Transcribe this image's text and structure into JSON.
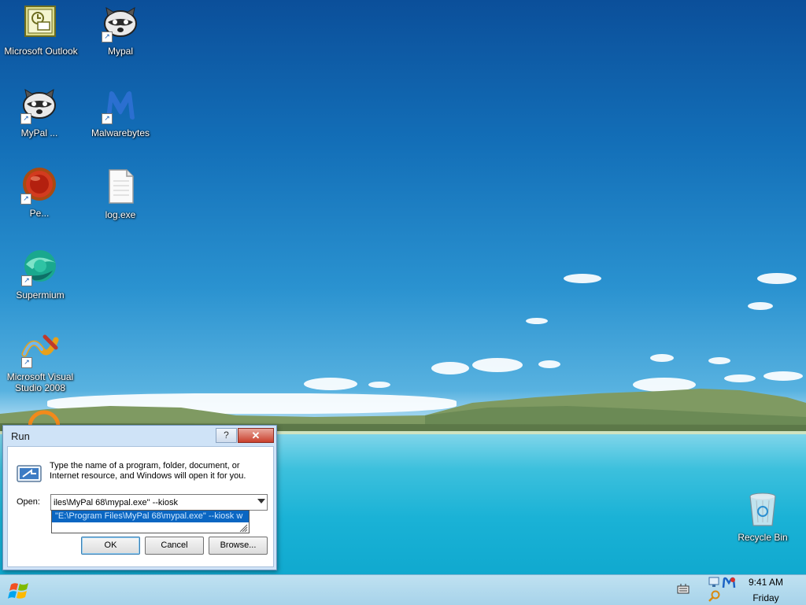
{
  "desktop": {
    "icons": [
      {
        "label": "Microsoft Outlook"
      },
      {
        "label": "Mypal"
      },
      {
        "label": "MyPal ..."
      },
      {
        "label": "Malwarebytes"
      },
      {
        "label": "Pe..."
      },
      {
        "label": "log.exe"
      },
      {
        "label": "Supermium"
      },
      {
        "label": "Microsoft Visual Studio 2008"
      },
      {
        "label": "Recycle Bin"
      }
    ]
  },
  "run_dialog": {
    "title": "Run",
    "help_label": "?",
    "close_label": "✕",
    "description": "Type the name of a program, folder, document, or Internet resource, and Windows will open it for you.",
    "open_label": "Open:",
    "open_value": "iles\\MyPal 68\\mypal.exe\" --kiosk",
    "autocomplete_item": "\"E:\\Program Files\\MyPal 68\\mypal.exe\" --kiosk w",
    "ok_label": "OK",
    "cancel_label": "Cancel",
    "browse_label": "Browse..."
  },
  "taskbar": {
    "clock_time": "9:41 AM",
    "clock_day": "Friday"
  },
  "colors": {
    "selection": "#0a66c2",
    "close_button": "#c9402c"
  }
}
